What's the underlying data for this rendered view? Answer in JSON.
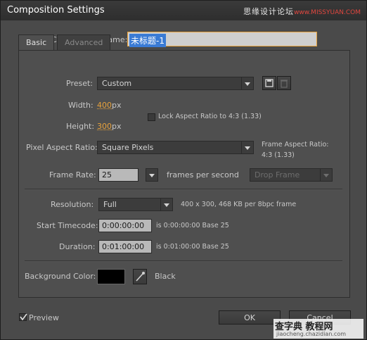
{
  "window": {
    "title": "Composition Settings",
    "watermark_top": "思缘设计论坛",
    "watermark_top_url": "www.MISSYUAN.COM"
  },
  "composition": {
    "name_label": "Composition Name:",
    "name_value": "未标题-1"
  },
  "tabs": [
    {
      "label": "Basic",
      "active": true
    },
    {
      "label": "Advanced",
      "active": false
    }
  ],
  "basic": {
    "preset_label": "Preset:",
    "preset_value": "Custom",
    "width_label": "Width:",
    "width_value": "400",
    "width_unit": "px",
    "height_label": "Height:",
    "height_value": "300",
    "height_unit": "px",
    "lock_aspect_label": "Lock Aspect Ratio to 4:3 (1.33)",
    "lock_aspect_checked": false,
    "par_label": "Pixel Aspect Ratio:",
    "par_value": "Square Pixels",
    "frame_aspect_label": "Frame Aspect Ratio:",
    "frame_aspect_value": "4:3 (1.33)",
    "frame_rate_label": "Frame Rate:",
    "frame_rate_value": "25",
    "frame_rate_unit": "frames per second",
    "drop_frame_value": "Drop Frame",
    "resolution_label": "Resolution:",
    "resolution_value": "Full",
    "resolution_info": "400 x 300, 468 KB per 8bpc frame",
    "start_tc_label": "Start Timecode:",
    "start_tc_value": "0:00:00:00",
    "start_tc_info": "is 0:00:00:00  Base 25",
    "duration_label": "Duration:",
    "duration_value": "0:01:00:00",
    "duration_info": "is 0:01:00:00  Base 25",
    "bg_label": "Background Color:",
    "bg_color": "#000000",
    "bg_name": "Black"
  },
  "footer": {
    "preview_label": "Preview",
    "preview_checked": true,
    "ok_label": "OK",
    "cancel_label": "Cancel"
  },
  "watermark_bottom": {
    "main": "查字典 教程网",
    "url": "jiaocheng.chazidian.com"
  },
  "colors": {
    "accent": "#e8a23c",
    "name_highlight": "#3a7bd5",
    "name_border": "#e8a23c"
  },
  "icons": {
    "save_preset": "save-icon",
    "delete_preset": "trash-icon",
    "eyedropper": "eyedropper-icon",
    "checkmark": "checkmark-icon"
  }
}
